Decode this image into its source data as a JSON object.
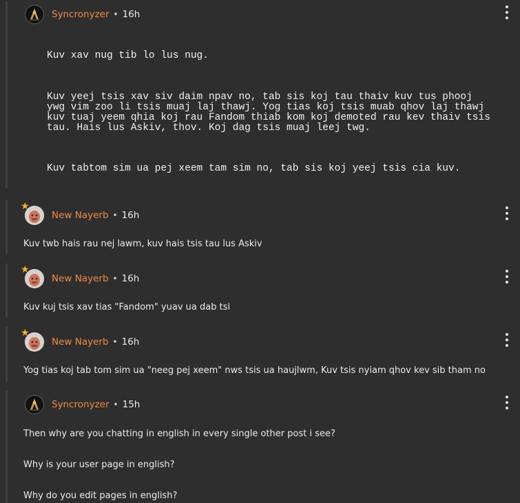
{
  "comments": [
    {
      "author": "Syncronyzer",
      "separator": "•",
      "time": "16h",
      "paragraphs": [
        "Kuv xav nug tib lo lus nug.",
        "Kuv yeej tsis xav siv daim npav no, tab sis koj tau thaiv kuv tus phooj ywg vim zoo li tsis muaj laj thawj. Yog tias koj tsis muab qhov laj thawj kuv tuaj yeem qhia koj rau Fandom thiab kom koj demoted rau kev thaiv tsis tau. Hais lus Askiv, thov. Koj dag tsis muaj leej twg.",
        "Kuv tabtom sim ua pej xeem tam sim no, tab sis koj yeej tsis cia kuv."
      ]
    },
    {
      "author": "New Nayerb",
      "separator": "•",
      "time": "16h",
      "text": "Kuv twb hais rau nej lawm, kuv hais tsis tau lus Askiv"
    },
    {
      "author": "New Nayerb",
      "separator": "•",
      "time": "16h",
      "text": "Kuv kuj tsis xav tias \"Fandom\" yuav ua dab tsi"
    },
    {
      "author": "New Nayerb",
      "separator": "•",
      "time": "16h",
      "text": "Yog tias koj tab tom sim ua \"neeg pej xeem\" nws tsis ua haujlwm, Kuv tsis nyiam qhov kev sib tham no"
    },
    {
      "author": "Syncronyzer",
      "separator": "•",
      "time": "15h",
      "paragraphs": [
        "Then why are you chatting in english in every single other post i see?",
        "Why is your user page in english?",
        "Why do you edit pages in english?"
      ]
    }
  ],
  "icons": {
    "more": "more-vertical-icon",
    "badge": "star-icon"
  },
  "colors": {
    "background": "#2e2e2e",
    "username": "#ef8d43",
    "text": "#ececec",
    "thread_line": "#3f3f3f",
    "badge": "#f2b72a"
  }
}
